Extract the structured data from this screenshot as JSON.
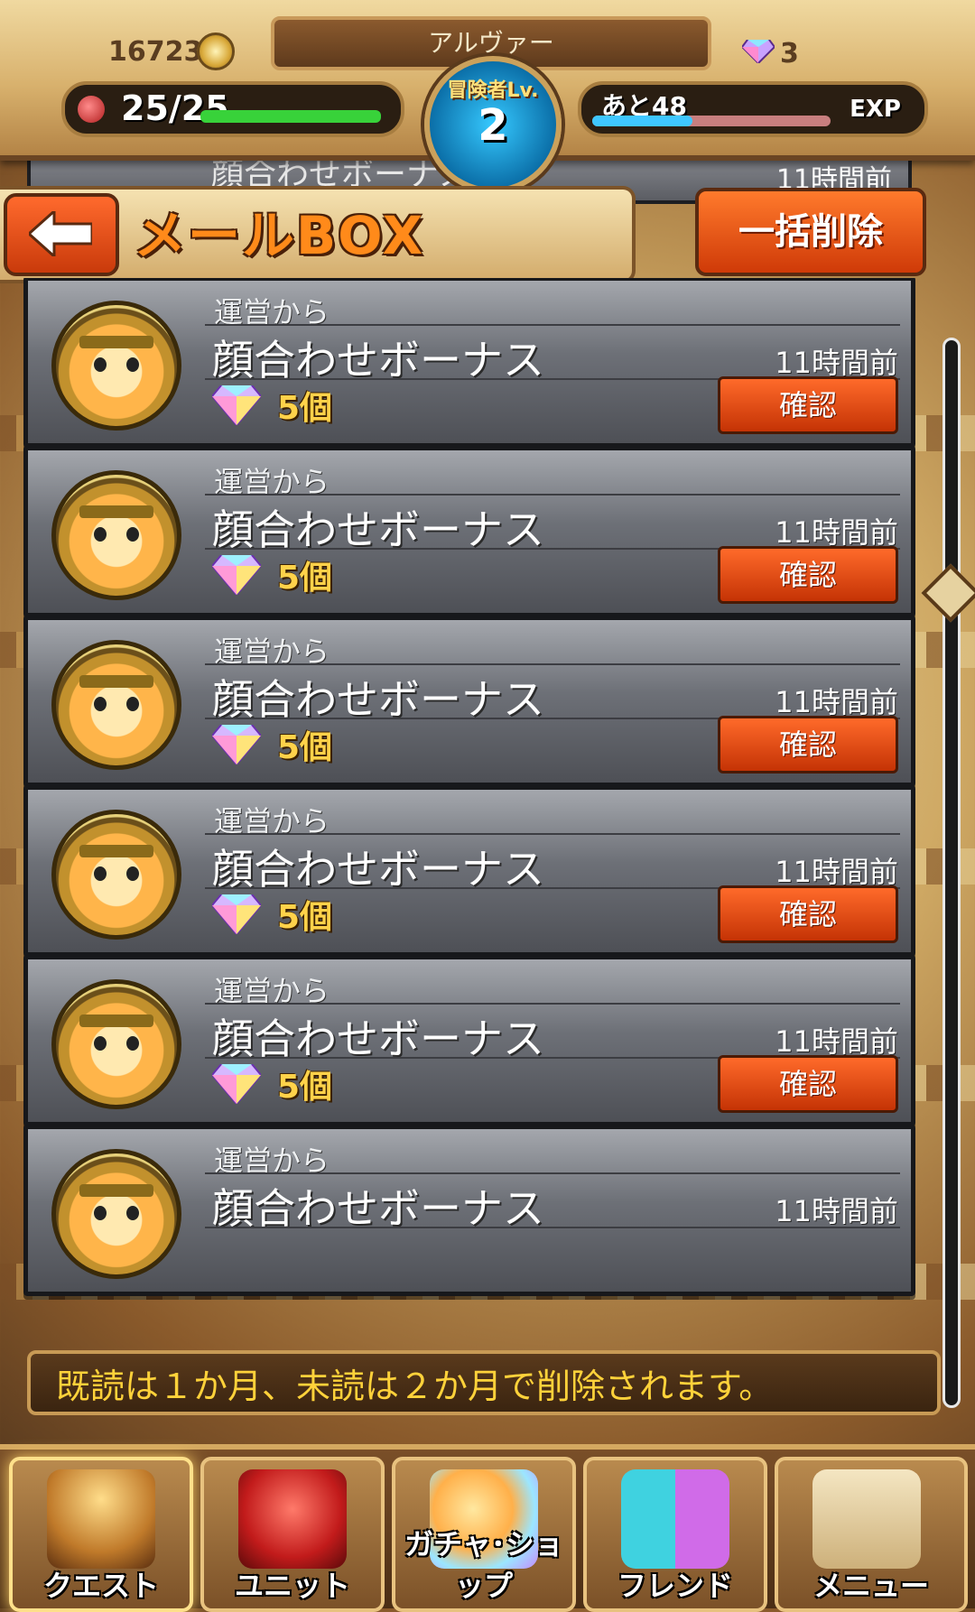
{
  "header": {
    "player_name": "アルヴァー",
    "coins": "16723",
    "gems": "3",
    "stamina": "25/25",
    "level_label": "冒険者Lv.",
    "level": "2",
    "exp_remaining": "あと48",
    "exp_label": "EXP",
    "exp_progress_fraction": 0.42
  },
  "title_bar": {
    "title": "メールBOX",
    "delete_all_label": "一括削除"
  },
  "mail_items": [
    {
      "sender": "運営から",
      "title": "顔合わせボーナス",
      "time": "11時間前",
      "reward_qty": "5個",
      "confirm_label": "確認"
    },
    {
      "sender": "運営から",
      "title": "顔合わせボーナス",
      "time": "11時間前",
      "reward_qty": "5個",
      "confirm_label": "確認"
    },
    {
      "sender": "運営から",
      "title": "顔合わせボーナス",
      "time": "11時間前",
      "reward_qty": "5個",
      "confirm_label": "確認"
    },
    {
      "sender": "運営から",
      "title": "顔合わせボーナス",
      "time": "11時間前",
      "reward_qty": "5個",
      "confirm_label": "確認"
    },
    {
      "sender": "運営から",
      "title": "顔合わせボーナス",
      "time": "11時間前",
      "reward_qty": "5個",
      "confirm_label": "確認"
    },
    {
      "sender": "運営から",
      "title": "顔合わせボーナス",
      "time": "11時間前"
    }
  ],
  "peek_item": {
    "title": "顔合わせボーナス",
    "time": "11時間前"
  },
  "notice": "既読は１か月、未読は２か月で削除されます。",
  "bottom_nav": [
    {
      "label": "クエスト",
      "icon": "door-icon"
    },
    {
      "label": "ユニット",
      "icon": "dragon-icon"
    },
    {
      "label": "ガチャ･ショップ",
      "icon": "gacha-icon"
    },
    {
      "label": "フレンド",
      "icon": "friends-icon"
    },
    {
      "label": "メニュー",
      "icon": "scroll-icon"
    }
  ]
}
